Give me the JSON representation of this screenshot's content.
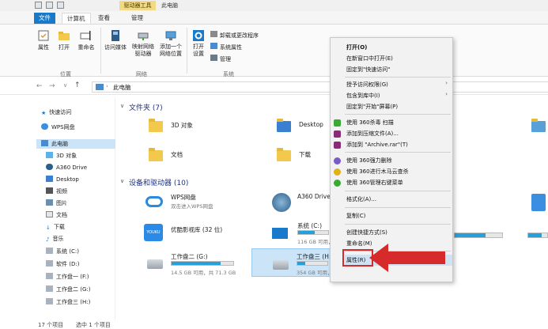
{
  "titlebar": {
    "tools_tab": "驱动器工具",
    "title": "此电脑"
  },
  "tabs": {
    "file": "文件",
    "computer": "计算机",
    "view": "查看",
    "manage": "管理"
  },
  "ribbon": {
    "properties": "属性",
    "open": "打开",
    "rename": "重命名",
    "access_media": "访问媒体",
    "map_drive_1": "映射网络",
    "map_drive_2": "驱动器",
    "add_location_1": "添加一个",
    "add_location_2": "网络位置",
    "open_settings_1": "打开",
    "open_settings_2": "设置",
    "uninstall": "卸载或更改程序",
    "system_props": "系统属性",
    "manage": "管理",
    "group_location": "位置",
    "group_network": "网络",
    "group_system": "系统"
  },
  "address": {
    "path": "此电脑"
  },
  "nav": {
    "quick": "快速访问",
    "wps": "WPS网盘",
    "pc": "此电脑",
    "obj3d": "3D 对象",
    "a360": "A360 Drive",
    "desktop": "Desktop",
    "video": "视频",
    "pictures": "图片",
    "docs": "文档",
    "downloads": "下载",
    "music": "音乐",
    "c": "系统 (C:)",
    "d": "软件 (D:)",
    "f": "工作盘一 (F:)",
    "g": "工作盘二 (G:)",
    "h": "工作盘三 (H:)"
  },
  "content": {
    "folders_header": "文件夹 (7)",
    "devices_header": "设备和驱动器 (10)",
    "f_3d": "3D 对象",
    "f_desktop": "Desktop",
    "f_docs": "文档",
    "f_downloads": "下载",
    "wps_name": "WPS网盘",
    "wps_sub": "双击进入WPS网盘",
    "a360_name": "A360 Drive",
    "youku_name": "优酷影视库 (32 位)",
    "sys_c_name": "系统 (C:)",
    "sys_c_sub": "116 GB 可用，共 ...",
    "g_name": "工作盘二 (G:)",
    "g_sub": "14.5 GB 可用，共 71.3 GB",
    "h_name": "工作盘三 (H:)",
    "h_sub": "354 GB 可用，共 482 GB"
  },
  "drives": {
    "g_used": 0.8,
    "h_used": 0.27,
    "c_used": 0.55
  },
  "context_menu": {
    "open": "打开(O)",
    "open_new_window": "在新窗口中打开(E)",
    "pin_quick": "固定到\"快速访问\"",
    "grant_access": "授予访问权限(G)",
    "include_library": "包含到库中(I)",
    "pin_start": "固定到\"开始\"屏幕(P)",
    "scan_360": "使用 360杀毒 扫描",
    "add_archive": "添加到压缩文件(A)...",
    "add_archive_rar": "添加到 \"Archive.rar\"(T)",
    "force_delete_360": "使用 360强力删除",
    "trojan_scan_360": "使用 360进行木马云查杀",
    "manage_menu_360": "使用 360管理右键菜单",
    "format": "格式化(A)...",
    "copy": "复制(C)",
    "create_shortcut": "创建快捷方式(S)",
    "rename": "重命名(M)",
    "properties": "属性(R)"
  },
  "status": {
    "count": "17 个项目",
    "selected": "选中 1 个项目"
  },
  "colors": {
    "accent": "#1979ca",
    "highlight": "#d72a2a",
    "selection": "#cce4f7"
  }
}
